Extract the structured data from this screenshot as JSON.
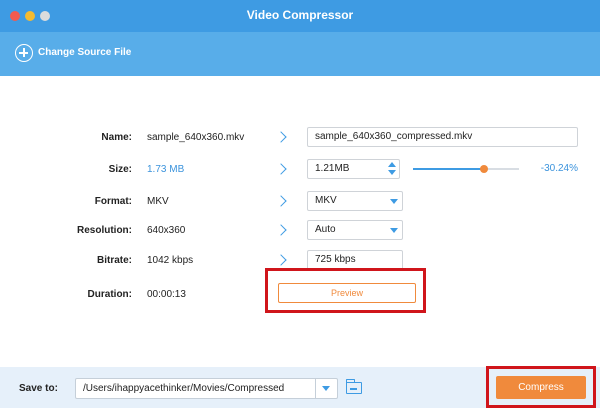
{
  "window": {
    "title": "Video Compressor"
  },
  "toolbar": {
    "change_source_label": "Change Source File"
  },
  "form": {
    "name": {
      "label": "Name:",
      "source": "sample_640x360.mkv",
      "output": "sample_640x360_compressed.mkv"
    },
    "size": {
      "label": "Size:",
      "source": "1.73 MB",
      "output": "1.21MB",
      "reduction_percent": "-30.24%",
      "slider_fraction": 0.67
    },
    "format": {
      "label": "Format:",
      "source": "MKV",
      "output": "MKV"
    },
    "resolution": {
      "label": "Resolution:",
      "source": "640x360",
      "output": "Auto"
    },
    "bitrate": {
      "label": "Bitrate:",
      "source": "1042 kbps",
      "output": "725 kbps"
    },
    "duration": {
      "label": "Duration:",
      "source": "00:00:13"
    }
  },
  "preview_button_label": "Preview",
  "footer": {
    "save_label": "Save to:",
    "save_path": "/Users/ihappyacethinker/Movies/Compressed",
    "compress_label": "Compress"
  },
  "colors": {
    "accent": "#3e9be3",
    "action": "#f08a3c",
    "highlight": "#d0151b"
  },
  "icons": [
    "add-circle-icon",
    "chevron-right-icon",
    "stepper-icon",
    "dropdown-arrow-icon",
    "folder-icon"
  ]
}
